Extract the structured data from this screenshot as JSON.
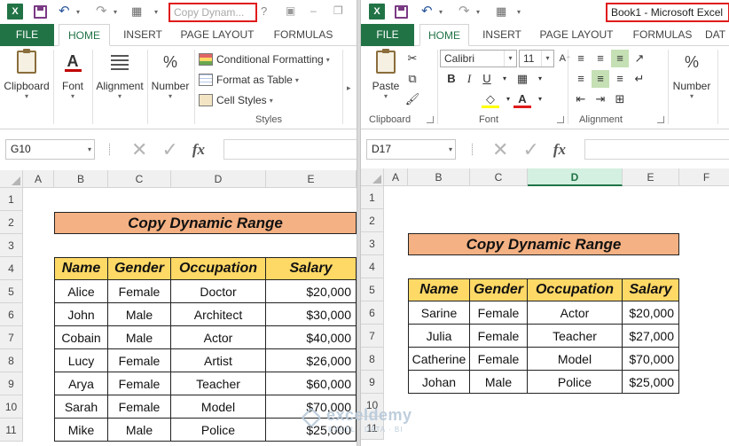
{
  "left": {
    "title": "Copy Dynam...",
    "tabs": [
      "FILE",
      "HOME",
      "INSERT",
      "PAGE LAYOUT",
      "FORMULAS"
    ],
    "ribbon": {
      "clipboard": "Clipboard",
      "font": "Font",
      "alignment": "Alignment",
      "number": "Number",
      "conditional_formatting": "Conditional Formatting",
      "format_as_table": "Format as Table",
      "cell_styles": "Cell Styles",
      "styles_label": "Styles"
    },
    "name_box": "G10",
    "columns": [
      "A",
      "B",
      "C",
      "D",
      "E"
    ],
    "rows": [
      "1",
      "2",
      "3",
      "4",
      "5",
      "6",
      "7",
      "8",
      "9",
      "10",
      "11"
    ],
    "banner": "Copy Dynamic Range",
    "table": {
      "headers": [
        "Name",
        "Gender",
        "Occupation",
        "Salary"
      ],
      "rows": [
        [
          "Alice",
          "Female",
          "Doctor",
          "$20,000"
        ],
        [
          "John",
          "Male",
          "Architect",
          "$30,000"
        ],
        [
          "Cobain",
          "Male",
          "Actor",
          "$40,000"
        ],
        [
          "Lucy",
          "Female",
          "Artist",
          "$26,000"
        ],
        [
          "Arya",
          "Female",
          "Teacher",
          "$60,000"
        ],
        [
          "Sarah",
          "Female",
          "Model",
          "$70,000"
        ],
        [
          "Mike",
          "Male",
          "Police",
          "$25,000"
        ]
      ]
    }
  },
  "right": {
    "title": "Book1 - Microsoft Excel",
    "tabs": [
      "FILE",
      "HOME",
      "INSERT",
      "PAGE LAYOUT",
      "FORMULAS",
      "DAT"
    ],
    "ribbon": {
      "paste": "Paste",
      "font_name": "Calibri",
      "font_size": "11",
      "clipboard_label": "Clipboard",
      "font_label": "Font",
      "alignment_label": "Alignment",
      "number": "Number",
      "bold": "B",
      "italic": "I",
      "underline": "U"
    },
    "name_box": "D17",
    "columns": [
      "A",
      "B",
      "C",
      "D",
      "E",
      "F"
    ],
    "selected_column": "D",
    "rows": [
      "1",
      "2",
      "3",
      "4",
      "5",
      "6",
      "7",
      "8",
      "9",
      "10",
      "11"
    ],
    "banner": "Copy Dynamic Range",
    "table": {
      "headers": [
        "Name",
        "Gender",
        "Occupation",
        "Salary"
      ],
      "rows": [
        [
          "Sarine",
          "Female",
          "Actor",
          "$20,000"
        ],
        [
          "Julia",
          "Female",
          "Teacher",
          "$27,000"
        ],
        [
          "Catherine",
          "Female",
          "Model",
          "$70,000"
        ],
        [
          "Johan",
          "Male",
          "Police",
          "$25,000"
        ]
      ]
    }
  },
  "watermark": {
    "name": "exceldemy",
    "tagline": "EXCEL · DATA · BI"
  },
  "colors": {
    "excel_green": "#217346",
    "banner_fill": "#f4b183",
    "header_fill": "#ffd966",
    "highlight_border": "#e01b1b"
  }
}
